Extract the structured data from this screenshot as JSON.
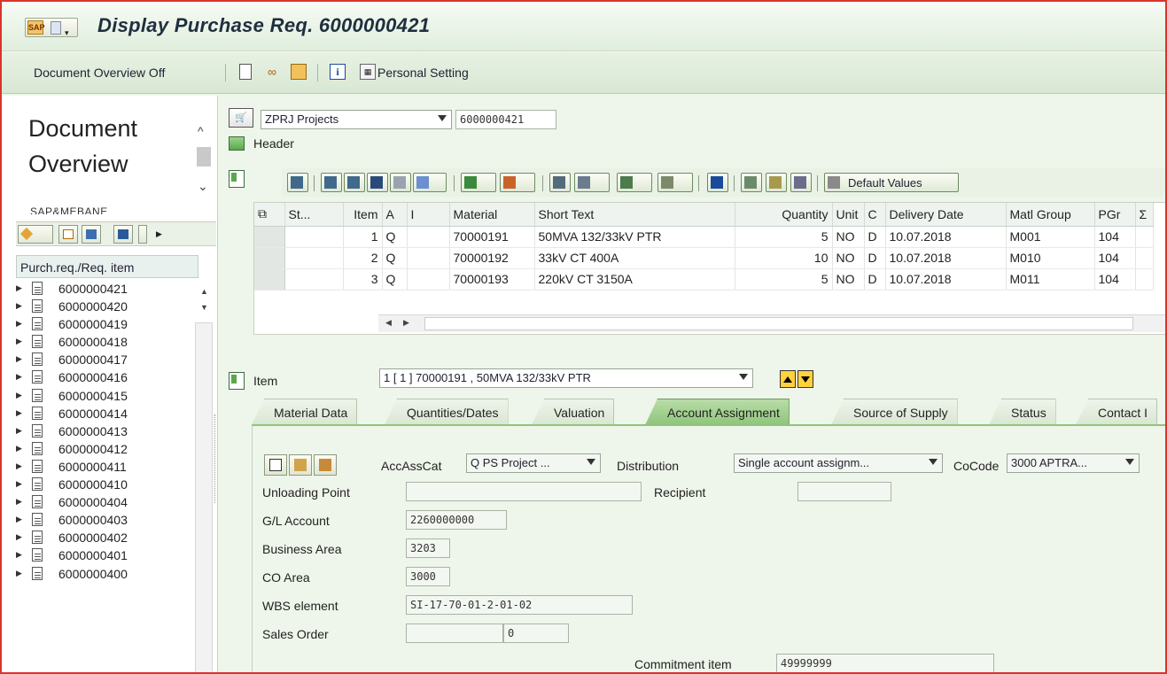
{
  "window": {
    "title": "Display Purchase Req. 6000000421"
  },
  "toolbar": {
    "doc_overview_label": "Document Overview Off",
    "personal_setting_label": "Personal Setting"
  },
  "left_panel": {
    "title_line1": "Document",
    "title_line2": "Overview",
    "user_label": "SAP&MEBANE",
    "column_header": "Purch.req./Req. item",
    "items": [
      "6000000421",
      "6000000420",
      "6000000419",
      "6000000418",
      "6000000417",
      "6000000416",
      "6000000415",
      "6000000414",
      "6000000413",
      "6000000412",
      "6000000411",
      "6000000410",
      "6000000404",
      "6000000403",
      "6000000402",
      "6000000401",
      "6000000400"
    ]
  },
  "header": {
    "doc_type_value": "ZPRJ Projects",
    "doc_number": "6000000421",
    "header_label": "Header"
  },
  "grid_toolbar": {
    "default_values_label": "Default Values"
  },
  "grid": {
    "columns": [
      "St...",
      "Item",
      "A",
      "I",
      "Material",
      "Short Text",
      "Quantity",
      "Unit",
      "C",
      "Delivery Date",
      "Matl Group",
      "PGr",
      "Σ"
    ],
    "rows": [
      {
        "item": "1",
        "a": "Q",
        "i": "",
        "material": "70000191",
        "short_text": "50MVA 132/33kV PTR",
        "quantity": "5",
        "unit": "NO",
        "c": "D",
        "delivery_date": "10.07.2018",
        "matl_group": "M001",
        "pgr": "104"
      },
      {
        "item": "2",
        "a": "Q",
        "i": "",
        "material": "70000192",
        "short_text": "33kV CT 400A",
        "quantity": "10",
        "unit": "NO",
        "c": "D",
        "delivery_date": "10.07.2018",
        "matl_group": "M010",
        "pgr": "104"
      },
      {
        "item": "3",
        "a": "Q",
        "i": "",
        "material": "70000193",
        "short_text": "220kV CT 3150A",
        "quantity": "5",
        "unit": "NO",
        "c": "D",
        "delivery_date": "10.07.2018",
        "matl_group": "M011",
        "pgr": "104"
      }
    ]
  },
  "item": {
    "label": "Item",
    "selected": "1 [ 1 ] 70000191 , 50MVA 132/33kV PTR"
  },
  "tabs": [
    {
      "label": "Material Data",
      "active": false
    },
    {
      "label": "Quantities/Dates",
      "active": false
    },
    {
      "label": "Valuation",
      "active": false
    },
    {
      "label": "Account Assignment",
      "active": true
    },
    {
      "label": "Source of Supply",
      "active": false
    },
    {
      "label": "Status",
      "active": false
    },
    {
      "label": "Contact I",
      "active": false
    }
  ],
  "account_assignment": {
    "acc_ass_cat_label": "AccAssCat",
    "acc_ass_cat_value": "Q PS Project ...",
    "distribution_label": "Distribution",
    "distribution_value": "Single account assignm...",
    "cocode_label": "CoCode",
    "cocode_value": "3000 APTRA...",
    "unloading_point_label": "Unloading Point",
    "unloading_point_value": "",
    "recipient_label": "Recipient",
    "recipient_value": "",
    "gl_account_label": "G/L Account",
    "gl_account_value": "2260000000",
    "business_area_label": "Business Area",
    "business_area_value": "3203",
    "co_area_label": "CO Area",
    "co_area_value": "3000",
    "wbs_label": "WBS element",
    "wbs_value": "SI-17-70-01-2-01-02",
    "sales_order_label": "Sales Order",
    "sales_order_value": "",
    "sales_order_item": "0",
    "commitment_item_label": "Commitment item",
    "commitment_item_value": "49999999"
  },
  "colors": {
    "accent": "#8ec57a",
    "background": "#eef5ea",
    "frame": "#d9342b"
  }
}
